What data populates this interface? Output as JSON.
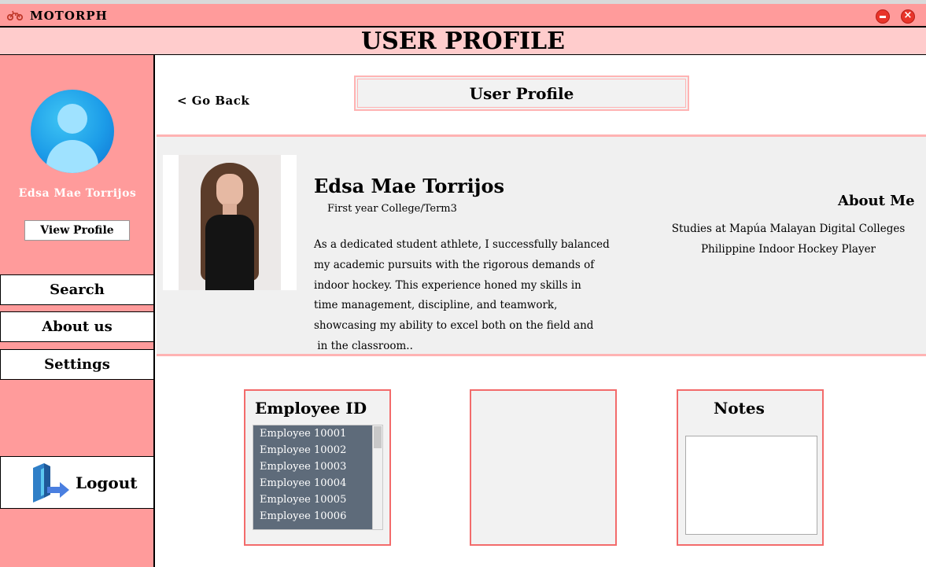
{
  "window": {
    "app_title": "MOTORPH",
    "logo_icon": "motorcycle-icon",
    "minimize_icon": "minimize-icon",
    "close_icon": "close-icon"
  },
  "header": {
    "title": "USER PROFILE"
  },
  "sidebar": {
    "avatar_icon": "user-avatar-icon",
    "username": "Edsa Mae Torrijos",
    "view_profile_label": "View Profile",
    "nav": [
      {
        "label": "Search"
      },
      {
        "label": "About us"
      },
      {
        "label": "Settings"
      }
    ],
    "logout_label": "Logout",
    "logout_icon": "logout-door-icon"
  },
  "main": {
    "go_back_label": "<  Go Back",
    "section_title": "User Profile",
    "profile": {
      "name": "Edsa Mae Torrijos",
      "level": "First year College/Term3",
      "bio_lines": [
        "As a dedicated student athlete, I successfully balanced",
        "my academic pursuits with the rigorous demands of",
        "indoor hockey. This experience honed my skills in",
        "time management, discipline, and teamwork,",
        "showcasing my ability to excel both on the field and",
        " in the classroom.."
      ],
      "about_title": "About Me",
      "about_lines": [
        "Studies at Mapúa Malayan Digital Colleges",
        "Philippine Indoor Hockey Player"
      ]
    },
    "cards": {
      "employee_title": "Employee ID",
      "employee_list": [
        "Employee 10001",
        "Employee 10002",
        "Employee 10003",
        "Employee 10004",
        "Employee 10005",
        "Employee 10006"
      ],
      "notes_title": "Notes",
      "notes_value": ""
    }
  },
  "colors": {
    "titlebar": "#ff9b9b",
    "header_bg": "#ffcccc",
    "sidebar_bg": "#ff9b9b",
    "card_border": "#f36b6b",
    "list_bg": "#5e6b7a"
  }
}
